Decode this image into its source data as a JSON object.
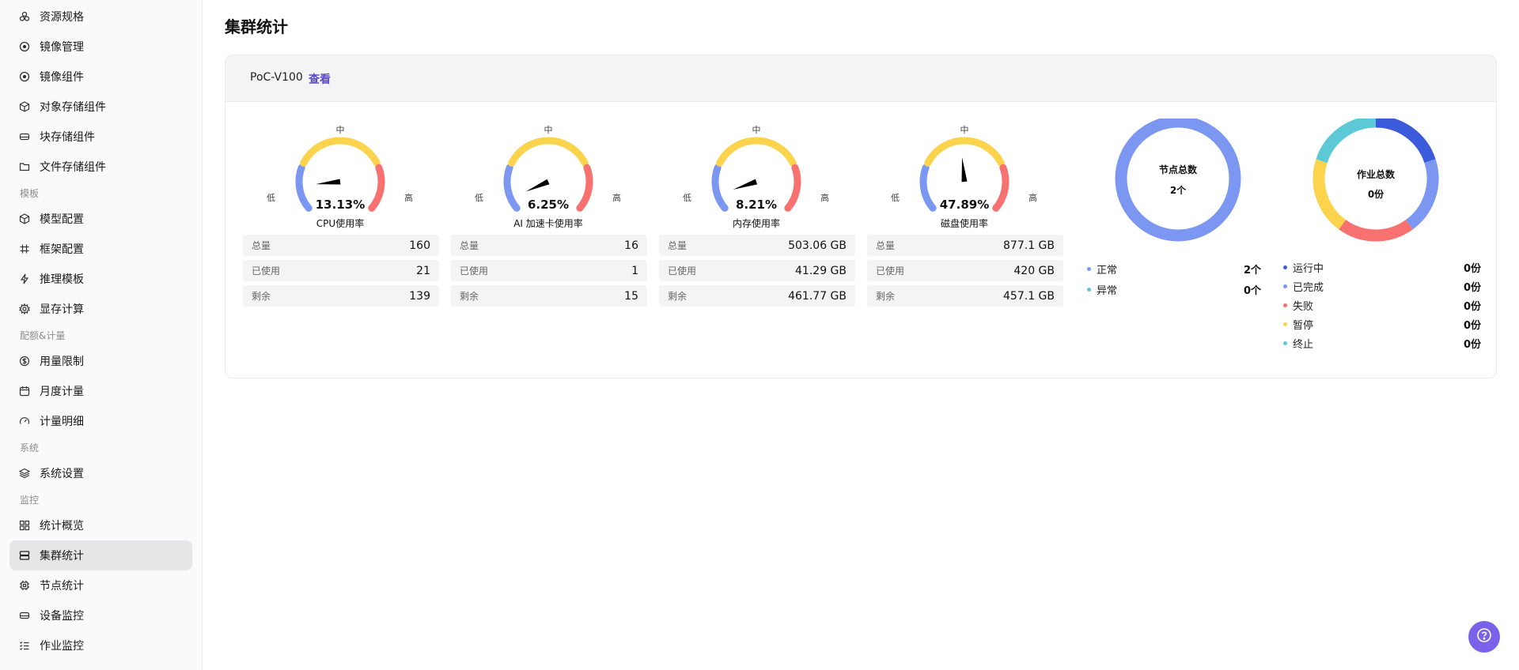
{
  "sidebar": {
    "items": [
      {
        "label": "资源规格",
        "icon": "resource-spec-icon"
      },
      {
        "label": "镜像管理",
        "icon": "image-manage-icon"
      },
      {
        "label": "镜像组件",
        "icon": "image-component-icon"
      },
      {
        "label": "对象存储组件",
        "icon": "object-storage-icon"
      },
      {
        "label": "块存储组件",
        "icon": "block-storage-icon"
      },
      {
        "label": "文件存储组件",
        "icon": "folder-icon"
      },
      {
        "label": "模型配置",
        "icon": "cube-icon"
      },
      {
        "label": "框架配置",
        "icon": "hash-icon"
      },
      {
        "label": "推理模板",
        "icon": "lightning-icon"
      },
      {
        "label": "显存计算",
        "icon": "gear-icon"
      },
      {
        "label": "用量限制",
        "icon": "dollar-icon"
      },
      {
        "label": "月度计量",
        "icon": "calendar-icon"
      },
      {
        "label": "计量明细",
        "icon": "gauge-icon"
      },
      {
        "label": "系统设置",
        "icon": "layers-icon"
      },
      {
        "label": "统计概览",
        "icon": "grid-icon"
      },
      {
        "label": "集群统计",
        "icon": "server-icon"
      },
      {
        "label": "节点统计",
        "icon": "chip-icon"
      },
      {
        "label": "设备监控",
        "icon": "drive-icon"
      },
      {
        "label": "作业监控",
        "icon": "checklist-icon"
      }
    ],
    "groups": [
      "模板",
      "配额&计量",
      "系统",
      "监控"
    ],
    "active": "集群统计"
  },
  "page": {
    "title": "集群统计"
  },
  "cluster": {
    "name": "PoC-V100",
    "view_link": "查看"
  },
  "gauge_labels": {
    "low": "低",
    "mid": "中",
    "high": "高"
  },
  "gauges": [
    {
      "name": "CPU使用率",
      "percent_text": "13.13%",
      "value": 13.13,
      "rows": [
        {
          "key": "总量",
          "value": "160"
        },
        {
          "key": "已使用",
          "value": "21"
        },
        {
          "key": "剩余",
          "value": "139"
        }
      ]
    },
    {
      "name": "AI 加速卡使用率",
      "percent_text": "6.25%",
      "value": 6.25,
      "rows": [
        {
          "key": "总量",
          "value": "16"
        },
        {
          "key": "已使用",
          "value": "1"
        },
        {
          "key": "剩余",
          "value": "15"
        }
      ]
    },
    {
      "name": "内存使用率",
      "percent_text": "8.21%",
      "value": 8.21,
      "rows": [
        {
          "key": "总量",
          "value": "503.06 GB"
        },
        {
          "key": "已使用",
          "value": "41.29 GB"
        },
        {
          "key": "剩余",
          "value": "461.77 GB"
        }
      ]
    },
    {
      "name": "磁盘使用率",
      "percent_text": "47.89%",
      "value": 47.89,
      "rows": [
        {
          "key": "总量",
          "value": "877.1 GB"
        },
        {
          "key": "已使用",
          "value": "420 GB"
        },
        {
          "key": "剩余",
          "value": "457.1 GB"
        }
      ]
    }
  ],
  "colors": {
    "low": "#7b97f2",
    "mid": "#fcd34d",
    "high": "#f87171",
    "accent": "#5b47d6"
  },
  "nodes": {
    "title": "节点总数",
    "total": "2个",
    "legend": [
      {
        "label": "正常",
        "value": "2个",
        "color": "#7b97f2"
      },
      {
        "label": "异常",
        "value": "0个",
        "color": "#5ec9d6"
      }
    ]
  },
  "jobs": {
    "title": "作业总数",
    "total": "0份",
    "legend": [
      {
        "label": "运行中",
        "value": "0份",
        "color": "#3b5bdb"
      },
      {
        "label": "已完成",
        "value": "0份",
        "color": "#7b97f2"
      },
      {
        "label": "失败",
        "value": "0份",
        "color": "#f87171"
      },
      {
        "label": "暂停",
        "value": "0份",
        "color": "#fcd34d"
      },
      {
        "label": "终止",
        "value": "0份",
        "color": "#5ec9d6"
      }
    ]
  }
}
